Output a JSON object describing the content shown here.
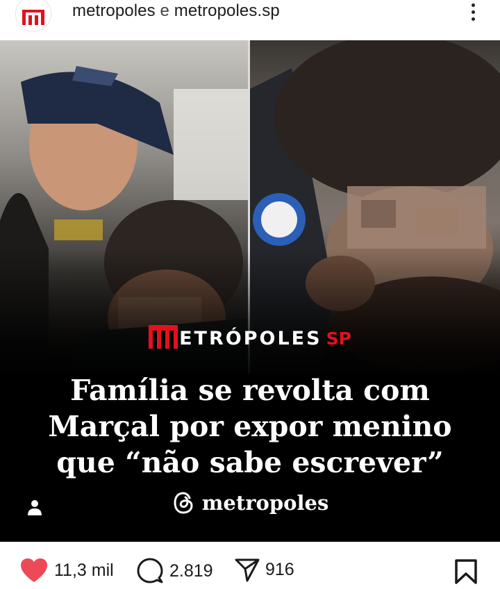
{
  "header": {
    "account_primary": "metropoles",
    "separator": "e",
    "account_secondary": "metropoles.sp",
    "avatar_icon": "metropoles-logo-icon",
    "more_icon": "more-vertical-icon"
  },
  "media": {
    "brand_name": "ETRÓPOLES",
    "brand_region": "SP",
    "headline_lines": [
      "Família se revolta com",
      "Marçal por expor menino",
      "que “não sabe escrever”"
    ],
    "threads_handle": "metropoles",
    "user_tag_icon": "user-tag-icon",
    "threads_icon": "threads-icon"
  },
  "actions": {
    "likes": "11,3 mil",
    "comments": "2.819",
    "shares": "916",
    "like_icon": "heart-icon",
    "comment_icon": "comment-icon",
    "share_icon": "send-icon",
    "save_icon": "bookmark-icon"
  },
  "colors": {
    "brand_red": "#e2111f",
    "like_red": "#ed4956",
    "media_background": "#000000"
  }
}
